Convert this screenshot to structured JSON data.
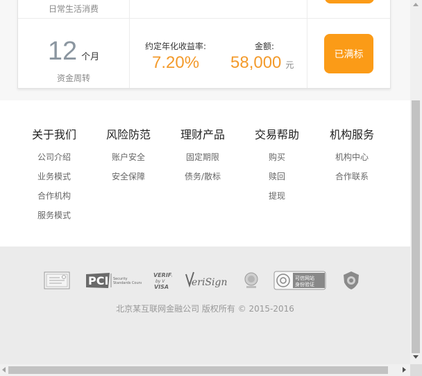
{
  "product_prev": {
    "term_label": "日常生活消费"
  },
  "product": {
    "term_number": "12",
    "term_unit": "个月",
    "term_label": "资金周转",
    "rate_label": "约定年化收益率:",
    "rate_value": "7.20%",
    "amount_label": "金额:",
    "amount_value": "58,000",
    "amount_unit": "元",
    "action_label": "已满标",
    "accent_color": "#fb9b17"
  },
  "footer_nav": {
    "columns": [
      {
        "title": "关于我们",
        "links": [
          "公司介绍",
          "业务模式",
          "合作机构",
          "服务模式"
        ]
      },
      {
        "title": "风险防范",
        "links": [
          "账户安全",
          "安全保障"
        ]
      },
      {
        "title": "理财产品",
        "links": [
          "固定期限",
          "债务/散标"
        ]
      },
      {
        "title": "交易帮助",
        "links": [
          "购买",
          "赎回",
          "提现"
        ]
      },
      {
        "title": "机构服务",
        "links": [
          "机构中心",
          "合作联系"
        ]
      }
    ]
  },
  "certifications": {
    "logos": [
      "license-certificate-icon",
      "pci-security-logo",
      "verified-by-visa-logo",
      "verisign-logo",
      "gov-emblem-icon",
      "online-identity-verification-logo",
      "police-badge-icon"
    ],
    "pci_text": "PCI",
    "pci_sub": "Security Standards Council",
    "visa_text": "VERIFIED by VISA",
    "verisign_text": "VeriSign",
    "identity_text": "可信网站 身份验证"
  },
  "copyright": "北京某互联网金融公司 版权所有 © 2015-2016"
}
